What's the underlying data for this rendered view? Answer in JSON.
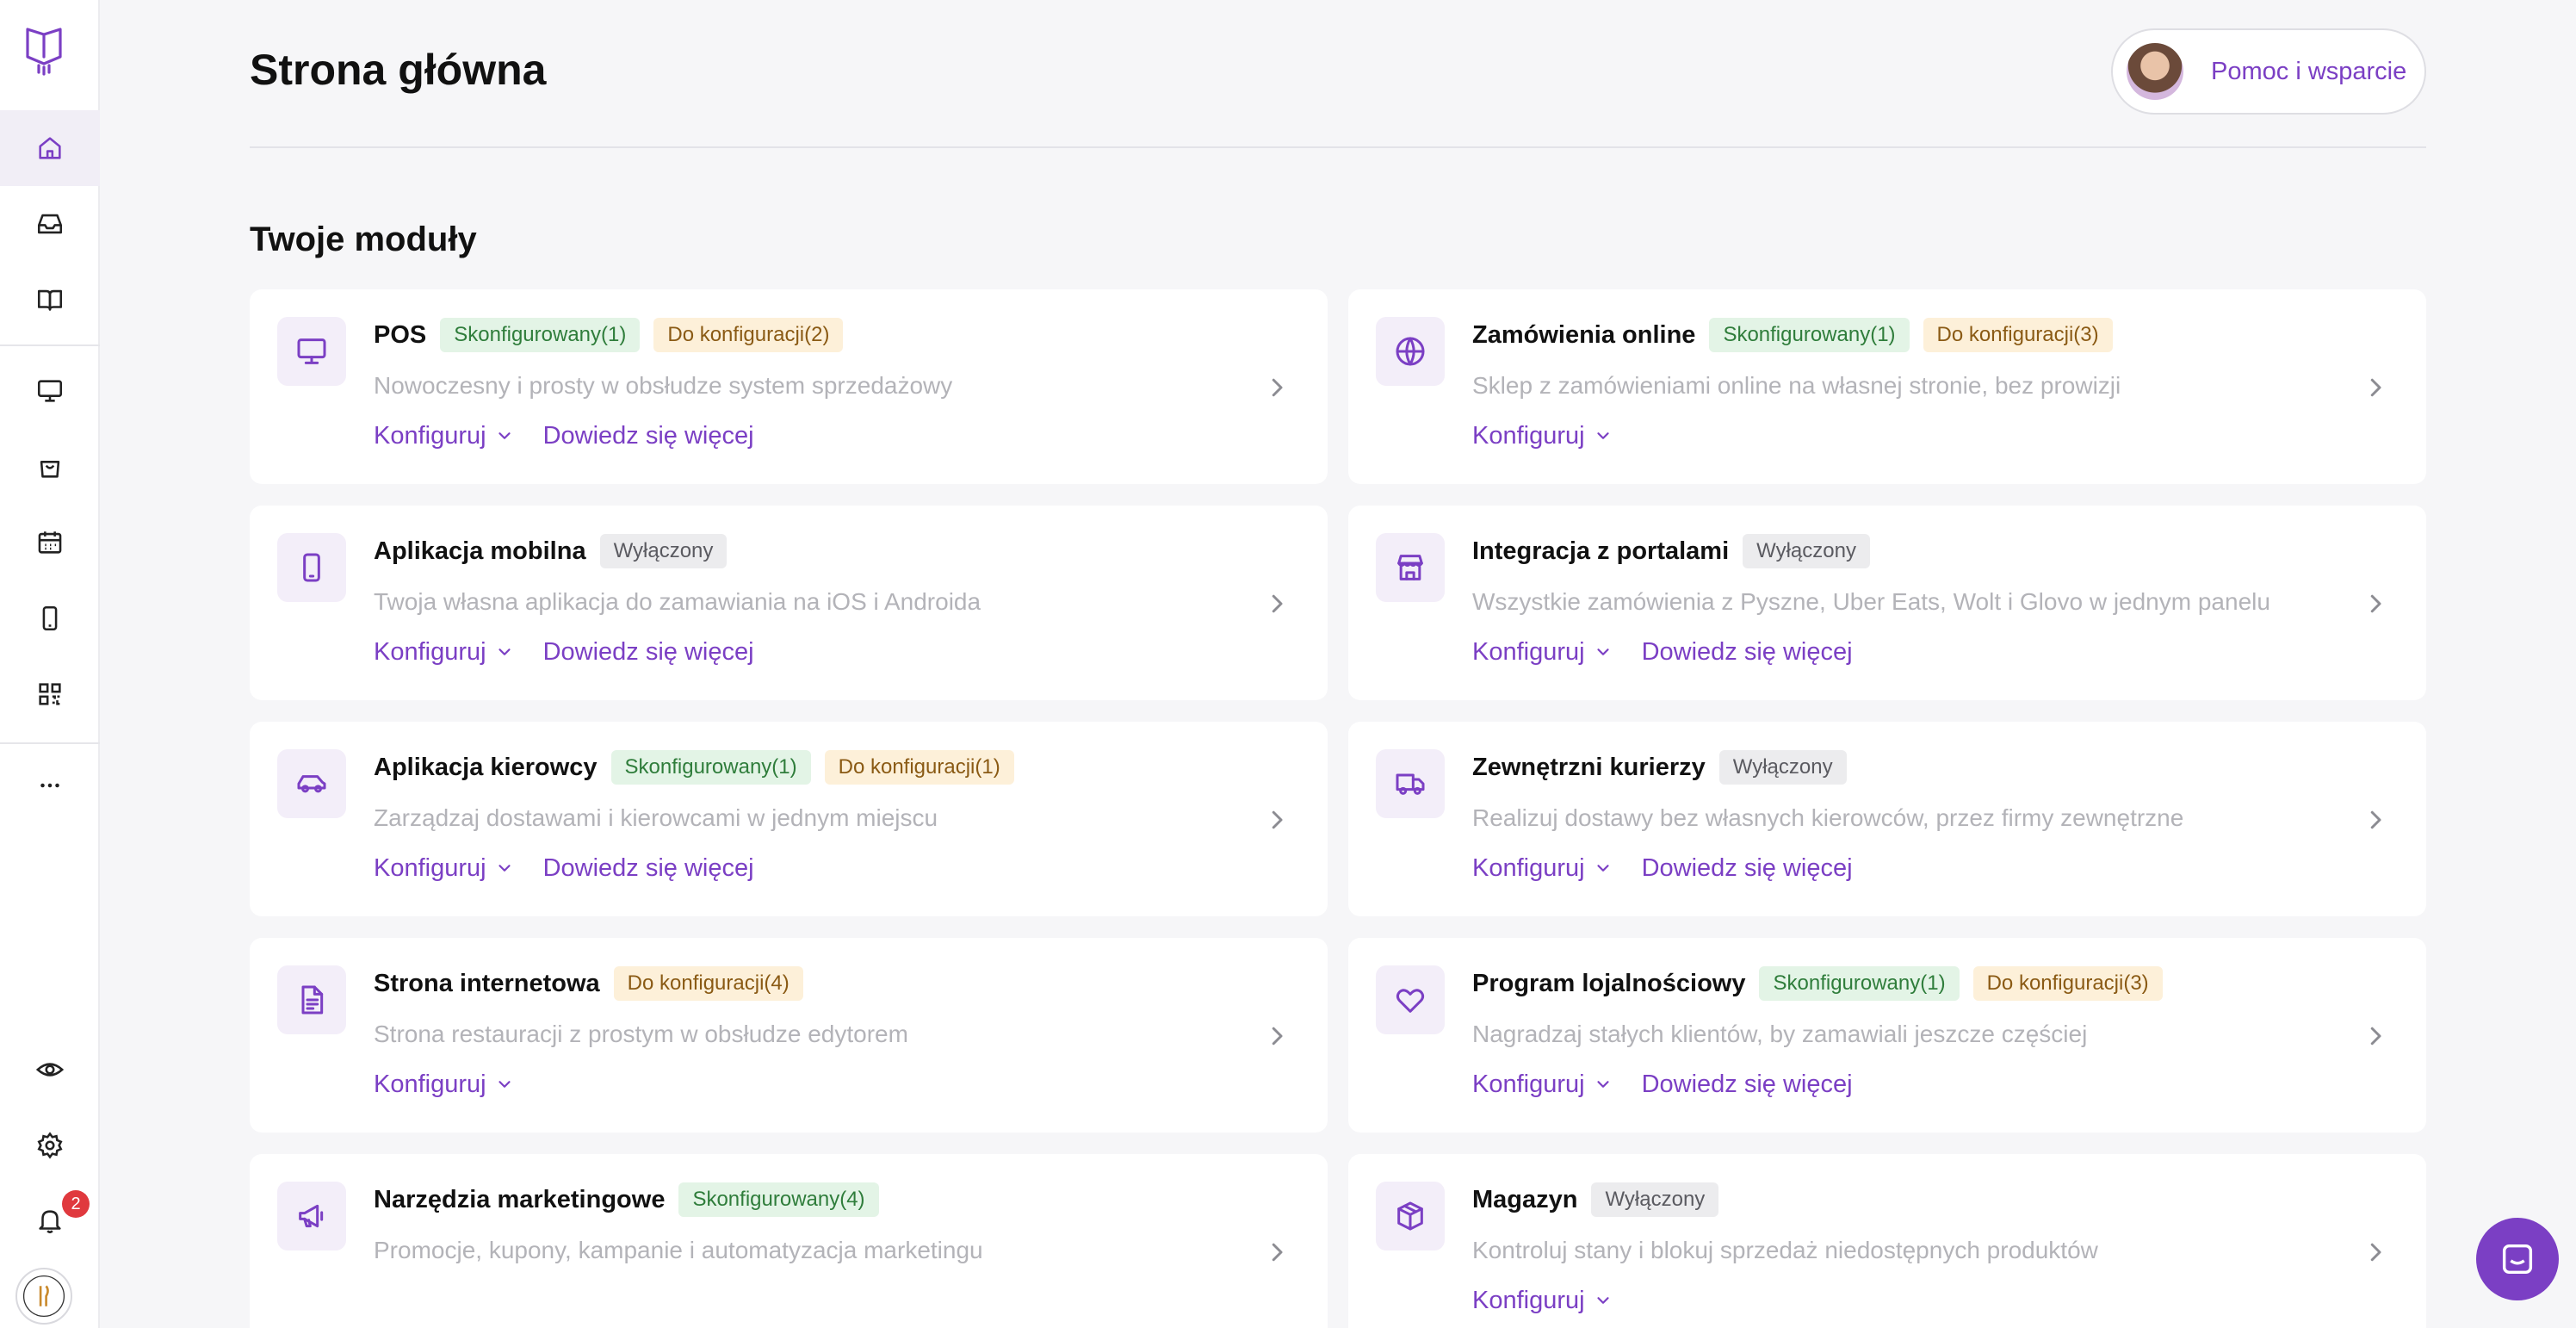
{
  "header": {
    "title": "Strona główna",
    "help_label": "Pomoc i wsparcie"
  },
  "section_title": "Twoje moduły",
  "sidebar": {
    "notification_count": "2",
    "items": [
      {
        "name": "home",
        "icon": "home-icon",
        "active": true
      },
      {
        "name": "inbox",
        "icon": "inbox-icon"
      },
      {
        "name": "menu",
        "icon": "book-icon"
      },
      {
        "name": "pos",
        "icon": "monitor-icon"
      },
      {
        "name": "orders",
        "icon": "shopping-bag-icon"
      },
      {
        "name": "calendar",
        "icon": "calendar-icon"
      },
      {
        "name": "mobile",
        "icon": "smartphone-icon"
      },
      {
        "name": "qr",
        "icon": "qr-code-icon"
      },
      {
        "name": "more",
        "icon": "more-icon"
      },
      {
        "name": "preview",
        "icon": "eye-icon"
      },
      {
        "name": "settings",
        "icon": "gear-icon"
      },
      {
        "name": "notifications",
        "icon": "bell-icon"
      }
    ]
  },
  "cards": [
    {
      "title": "POS",
      "icon": "monitor-icon",
      "tags": [
        {
          "text": "Skonfigurowany(1)",
          "type": "green"
        },
        {
          "text": "Do konfiguracji(2)",
          "type": "yellow"
        }
      ],
      "desc": "Nowoczesny i prosty w obsłudze system sprzedażowy",
      "config_label": "Konfiguruj",
      "more_label": "Dowiedz się więcej"
    },
    {
      "title": "Zamówienia online",
      "icon": "globe-icon",
      "tags": [
        {
          "text": "Skonfigurowany(1)",
          "type": "green"
        },
        {
          "text": "Do konfiguracji(3)",
          "type": "yellow"
        }
      ],
      "desc": "Sklep z zamówieniami online na własnej stronie, bez prowizji",
      "config_label": "Konfiguruj",
      "more_label": ""
    },
    {
      "title": "Aplikacja mobilna",
      "icon": "smartphone-icon",
      "tags": [
        {
          "text": "Wyłączony",
          "type": "gray"
        }
      ],
      "desc": "Twoja własna aplikacja do zamawiania na iOS i Androida",
      "config_label": "Konfiguruj",
      "more_label": "Dowiedz się więcej"
    },
    {
      "title": "Integracja z portalami",
      "icon": "store-icon",
      "tags": [
        {
          "text": "Wyłączony",
          "type": "gray"
        }
      ],
      "desc": "Wszystkie zamówienia z Pyszne, Uber Eats, Wolt i Glovo w jednym panelu",
      "config_label": "Konfiguruj",
      "more_label": "Dowiedz się więcej"
    },
    {
      "title": "Aplikacja kierowcy",
      "icon": "car-icon",
      "tags": [
        {
          "text": "Skonfigurowany(1)",
          "type": "green"
        },
        {
          "text": "Do konfiguracji(1)",
          "type": "yellow"
        }
      ],
      "desc": "Zarządzaj dostawami i kierowcami w jednym miejscu",
      "config_label": "Konfiguruj",
      "more_label": "Dowiedz się więcej"
    },
    {
      "title": "Zewnętrzni kurierzy",
      "icon": "truck-icon",
      "tags": [
        {
          "text": "Wyłączony",
          "type": "gray"
        }
      ],
      "desc": "Realizuj dostawy bez własnych kierowców, przez firmy zewnętrzne",
      "config_label": "Konfiguruj",
      "more_label": "Dowiedz się więcej"
    },
    {
      "title": "Strona internetowa",
      "icon": "document-icon",
      "tags": [
        {
          "text": "Do konfiguracji(4)",
          "type": "yellow"
        }
      ],
      "desc": "Strona restauracji z prostym w obsłudze edytorem",
      "config_label": "Konfiguruj",
      "more_label": ""
    },
    {
      "title": "Program lojalnościowy",
      "icon": "heart-icon",
      "tags": [
        {
          "text": "Skonfigurowany(1)",
          "type": "green"
        },
        {
          "text": "Do konfiguracji(3)",
          "type": "yellow"
        }
      ],
      "desc": "Nagradzaj stałych klientów, by zamawiali jeszcze częściej",
      "config_label": "Konfiguruj",
      "more_label": "Dowiedz się więcej"
    },
    {
      "title": "Narzędzia marketingowe",
      "icon": "megaphone-icon",
      "tags": [
        {
          "text": "Skonfigurowany(4)",
          "type": "green"
        }
      ],
      "desc": "Promocje, kupony, kampanie i automatyzacja marketingu",
      "config_label": "",
      "more_label": ""
    },
    {
      "title": "Magazyn",
      "icon": "box-icon",
      "tags": [
        {
          "text": "Wyłączony",
          "type": "gray"
        }
      ],
      "desc": "Kontroluj stany i blokuj sprzedaż niedostępnych produktów",
      "config_label": "Konfiguruj",
      "more_label": ""
    }
  ],
  "colors": {
    "accent": "#7b3fc4",
    "background": "#f6f6f8",
    "badge": "#e0393e"
  }
}
